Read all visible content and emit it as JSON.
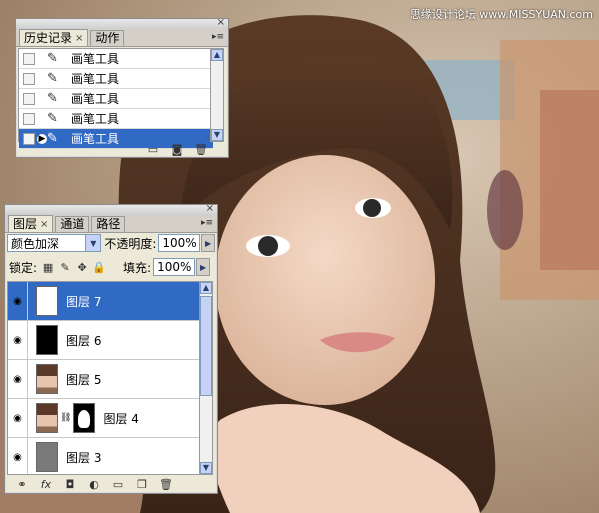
{
  "watermark": "思缘设计论坛 www.MISSYUAN.com",
  "history_panel": {
    "tabs": [
      {
        "label": "历史记录",
        "active": true
      },
      {
        "label": "动作",
        "active": false
      }
    ],
    "items": [
      {
        "label": "画笔工具",
        "selected": false
      },
      {
        "label": "画笔工具",
        "selected": false
      },
      {
        "label": "画笔工具",
        "selected": false
      },
      {
        "label": "画笔工具",
        "selected": false
      },
      {
        "label": "画笔工具",
        "selected": true
      }
    ],
    "footer_icons": [
      "new-document-icon",
      "camera-icon",
      "trash-icon"
    ]
  },
  "layers_panel": {
    "tabs": [
      {
        "label": "图层",
        "active": true
      },
      {
        "label": "通道",
        "active": false
      },
      {
        "label": "路径",
        "active": false
      }
    ],
    "blend_mode": "颜色加深",
    "opacity_label": "不透明度:",
    "opacity_value": "100%",
    "lock_label": "锁定:",
    "fill_label": "填充:",
    "fill_value": "100%",
    "layers": [
      {
        "name": "图层 7",
        "thumb": "white",
        "selected": true,
        "mask": false
      },
      {
        "name": "图层 6",
        "thumb": "black",
        "selected": false,
        "mask": false
      },
      {
        "name": "图层 5",
        "thumb": "photo",
        "selected": false,
        "mask": false
      },
      {
        "name": "图层 4",
        "thumb": "photo",
        "selected": false,
        "mask": true
      },
      {
        "name": "图层 3",
        "thumb": "gray",
        "selected": false,
        "mask": false
      }
    ],
    "footer_icons": [
      "link-icon",
      "fx-icon",
      "mask-icon",
      "adjustment-icon",
      "folder-icon",
      "new-layer-icon",
      "trash-icon"
    ]
  },
  "colors": {
    "selection": "#316ac5",
    "panel_bg": "#ece9d8"
  }
}
